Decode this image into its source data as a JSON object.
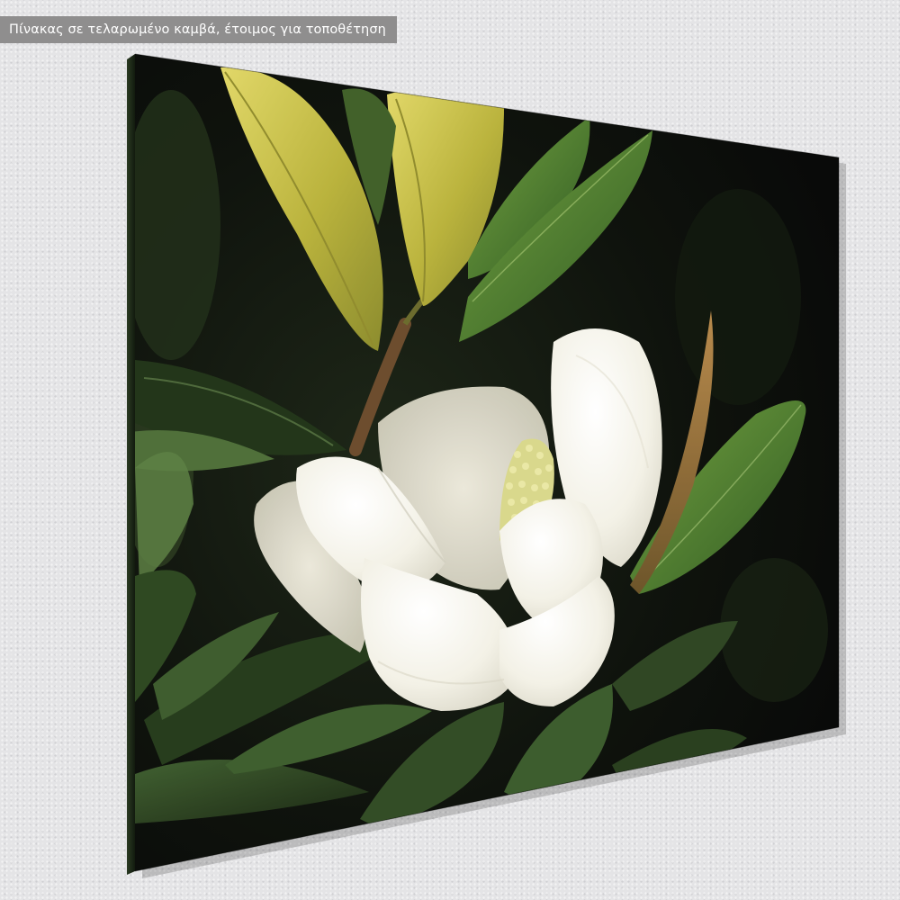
{
  "caption": {
    "text": "Πίνακας σε τελαρωμένο καμβά,  έτοιμος για τοποθέτηση"
  },
  "colors": {
    "wall": "#e4e4e6",
    "caption_background": "#8f8e8e",
    "caption_text": "#ffffff",
    "canvas_background": "#0a0d08",
    "petal": "#f6f4ec",
    "leaf_dark": "#2f4a22",
    "leaf_yellow": "#c7c24a"
  },
  "artwork": {
    "subject": "white magnolia flower with green leaves on dark background",
    "icons": [
      "canvas-print",
      "magnolia-flower"
    ]
  }
}
